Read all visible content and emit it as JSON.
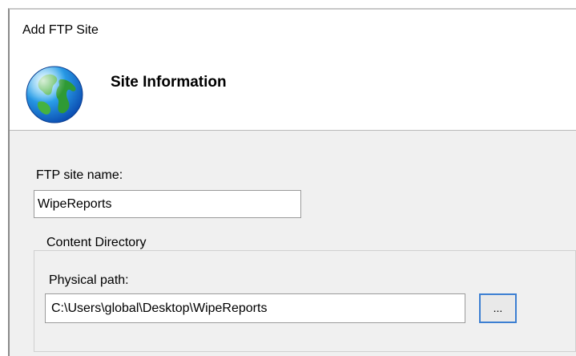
{
  "dialog": {
    "title": "Add FTP Site",
    "section_title": "Site Information",
    "globe_icon": "globe-icon"
  },
  "form": {
    "site_name_label": "FTP site name:",
    "site_name_value": "WipeReports",
    "content_directory_label": "Content Directory",
    "physical_path_label": "Physical path:",
    "physical_path_value": "C:\\Users\\global\\Desktop\\WipeReports",
    "browse_button_label": "..."
  },
  "colors": {
    "focus_border": "#3c7fd2",
    "panel_background": "#f0f0f0",
    "header_background": "#ffffff"
  }
}
